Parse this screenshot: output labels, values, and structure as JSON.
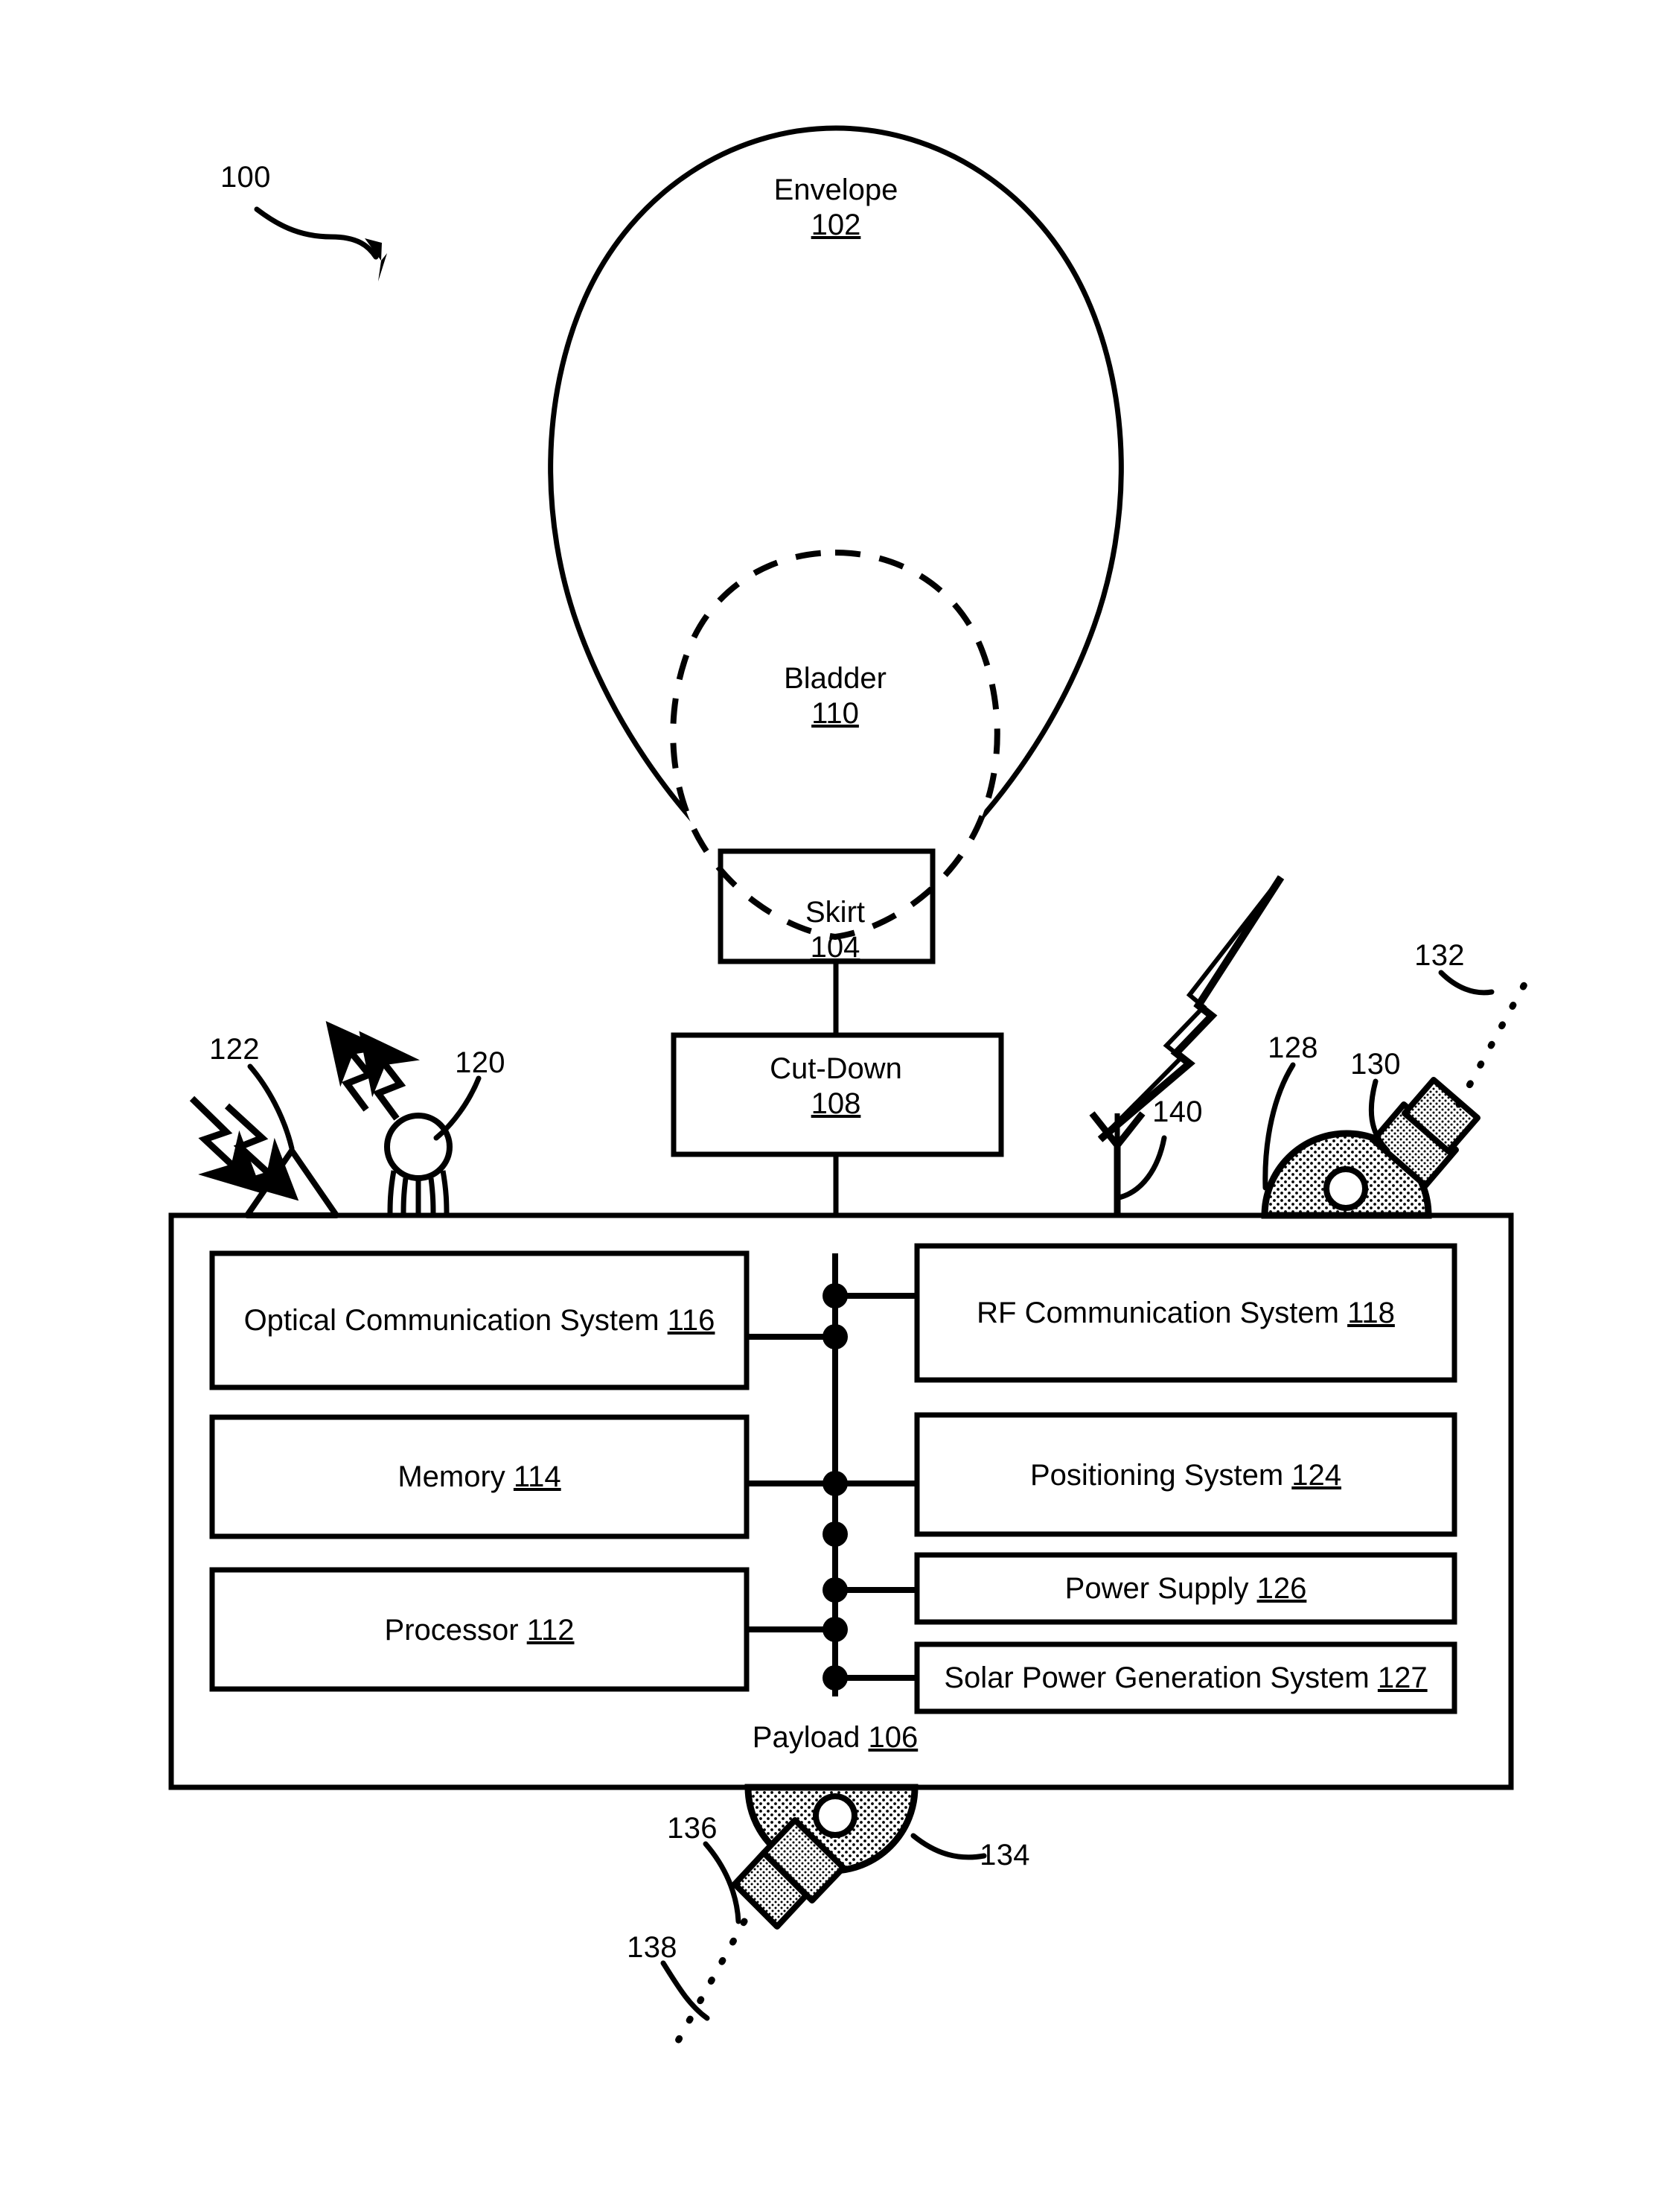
{
  "figure": {
    "ref_main": "100",
    "components": {
      "envelope": {
        "label": "Envelope",
        "num": "102"
      },
      "bladder": {
        "label": "Bladder",
        "num": "110"
      },
      "skirt": {
        "label": "Skirt",
        "num": "104"
      },
      "cutdown": {
        "label": "Cut-Down",
        "num": "108"
      },
      "payload": {
        "label": "Payload",
        "num": "106"
      }
    },
    "payload_modules_left": [
      {
        "label": "Optical Communication System",
        "num": "116"
      },
      {
        "label": "Memory",
        "num": "114"
      },
      {
        "label": "Processor",
        "num": "112"
      }
    ],
    "payload_modules_right": [
      {
        "label": "RF Communication System",
        "num": "118"
      },
      {
        "label": "Positioning System",
        "num": "124"
      },
      {
        "label": "Power Supply",
        "num": "126"
      },
      {
        "label": "Solar Power Generation System",
        "num": "127"
      }
    ],
    "callouts": [
      {
        "ref": "122",
        "name": "incoming-solar-rays"
      },
      {
        "ref": "120",
        "name": "optical-transmitter"
      },
      {
        "ref": "140",
        "name": "rf-antenna"
      },
      {
        "ref": "128",
        "name": "upper-gimbal-dome"
      },
      {
        "ref": "130",
        "name": "upper-optical-tube"
      },
      {
        "ref": "132",
        "name": "upper-optical-beam"
      },
      {
        "ref": "134",
        "name": "lower-gimbal-dome"
      },
      {
        "ref": "136",
        "name": "lower-optical-tube"
      },
      {
        "ref": "138",
        "name": "lower-optical-beam"
      }
    ],
    "colors": {
      "line": "#000000",
      "background": "#ffffff",
      "fill": "#ffffff"
    }
  }
}
